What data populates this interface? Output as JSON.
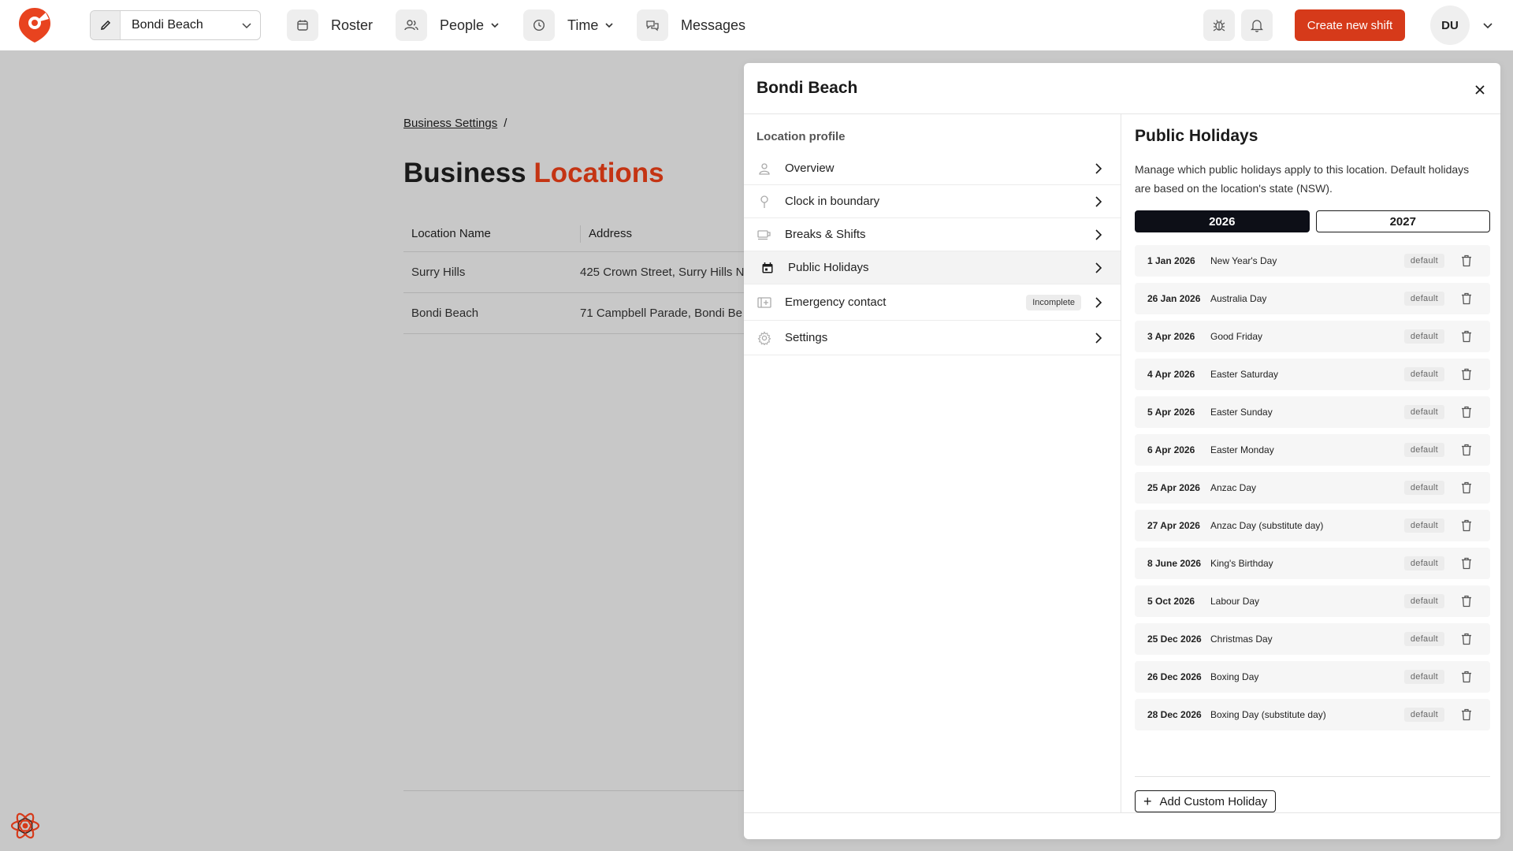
{
  "topbar": {
    "location_select": "Bondi Beach",
    "nav": [
      {
        "label": "Roster",
        "icon": "calendar-icon"
      },
      {
        "label": "People",
        "icon": "people-icon"
      },
      {
        "label": "Time",
        "icon": "clock-icon"
      },
      {
        "label": "Messages",
        "icon": "chat-icon"
      }
    ],
    "create_button": "Create new shift",
    "avatar_initials": "DU",
    "brand_color": "#d63a1a"
  },
  "page": {
    "breadcrumb": "Business Settings",
    "breadcrumb_sep": "/",
    "title_part1": "Business",
    "title_part2": "Locations",
    "columns": [
      "Location Name",
      "Address"
    ],
    "rows": [
      {
        "name": "Surry Hills",
        "address": "425 Crown Street, Surry Hills N"
      },
      {
        "name": "Bondi Beach",
        "address": "71 Campbell Parade, Bondi Be"
      }
    ]
  },
  "drawer": {
    "title": "Bondi Beach",
    "section_label": "Location profile",
    "menu": [
      {
        "label": "Overview",
        "icon": "person-icon",
        "badge": ""
      },
      {
        "label": "Clock in boundary",
        "icon": "pin-icon",
        "badge": ""
      },
      {
        "label": "Breaks & Shifts",
        "icon": "coffee-icon",
        "badge": ""
      },
      {
        "label": "Public Holidays",
        "icon": "calendar-icon",
        "badge": ""
      },
      {
        "label": "Emergency contact",
        "icon": "contact-icon",
        "badge": "Incomplete"
      },
      {
        "label": "Settings",
        "icon": "gear-icon",
        "badge": ""
      }
    ],
    "active_menu_index": 3,
    "holidays_panel": {
      "title": "Public Holidays",
      "description": "Manage which public holidays apply to this location. Default holidays are based on the location's state (NSW).",
      "years": [
        "2026",
        "2027"
      ],
      "active_year": "2026",
      "holidays": [
        {
          "date": "1 Jan 2026",
          "name": "New Year's Day",
          "badge": "default"
        },
        {
          "date": "26 Jan 2026",
          "name": "Australia Day",
          "badge": "default"
        },
        {
          "date": "3 Apr 2026",
          "name": "Good Friday",
          "badge": "default"
        },
        {
          "date": "4 Apr 2026",
          "name": "Easter Saturday",
          "badge": "default"
        },
        {
          "date": "5 Apr 2026",
          "name": "Easter Sunday",
          "badge": "default"
        },
        {
          "date": "6 Apr 2026",
          "name": "Easter Monday",
          "badge": "default"
        },
        {
          "date": "25 Apr 2026",
          "name": "Anzac Day",
          "badge": "default"
        },
        {
          "date": "27 Apr 2026",
          "name": "Anzac Day (substitute day)",
          "badge": "default"
        },
        {
          "date": "8 June 2026",
          "name": "King's Birthday",
          "badge": "default"
        },
        {
          "date": "5 Oct 2026",
          "name": "Labour Day",
          "badge": "default"
        },
        {
          "date": "25 Dec 2026",
          "name": "Christmas Day",
          "badge": "default"
        },
        {
          "date": "26 Dec 2026",
          "name": "Boxing Day",
          "badge": "default"
        },
        {
          "date": "28 Dec 2026",
          "name": "Boxing Day (substitute day)",
          "badge": "default"
        }
      ],
      "add_button": "Add Custom Holiday"
    }
  }
}
